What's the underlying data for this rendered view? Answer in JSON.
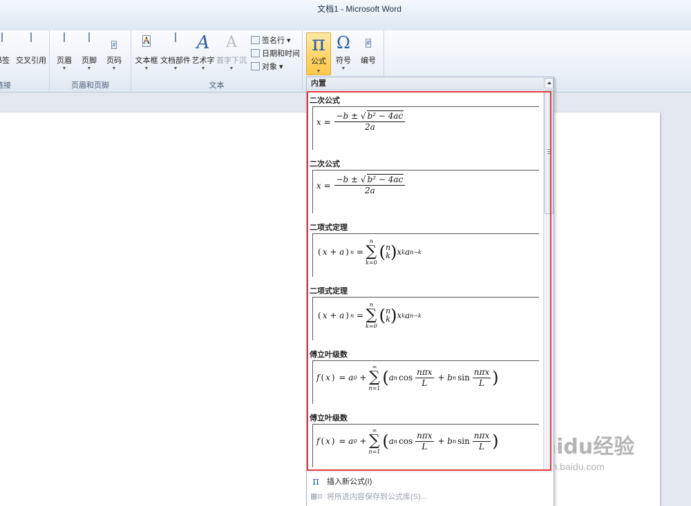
{
  "window": {
    "title": "文档1 - Microsoft Word"
  },
  "ribbon": {
    "groups": [
      {
        "label": "链接",
        "buttons": [
          {
            "label": "书签"
          },
          {
            "label": "交叉引用"
          }
        ]
      },
      {
        "label": "页眉和页脚",
        "buttons": [
          {
            "label": "页眉"
          },
          {
            "label": "页脚"
          },
          {
            "label": "页码"
          }
        ]
      },
      {
        "label": "文本",
        "buttons": [
          {
            "label": "文本框"
          },
          {
            "label": "文档部件"
          },
          {
            "label": "艺术字"
          },
          {
            "label": "首字下沉"
          }
        ],
        "small_buttons": [
          {
            "label": "签名行 ▾"
          },
          {
            "label": "日期和时间"
          },
          {
            "label": "对象 ▾"
          }
        ]
      },
      {
        "label": "",
        "buttons": [
          {
            "label": "公式",
            "glyph": "π"
          },
          {
            "label": "符号",
            "glyph": "Ω"
          },
          {
            "label": "编号",
            "glyph": "#"
          }
        ]
      }
    ]
  },
  "gallery": {
    "header": "内置",
    "items": [
      {
        "title": "二次公式"
      },
      {
        "title": "二次公式"
      },
      {
        "title": "二项式定理"
      },
      {
        "title": "二项式定理"
      },
      {
        "title": "傅立叶级数"
      },
      {
        "title": "傅立叶级数"
      }
    ],
    "menu": [
      {
        "label": "插入新公式(I)",
        "icon": "pi-icon",
        "enabled": true
      },
      {
        "label": "将所选内容保存到公式库(S)...",
        "icon": "save-to-gallery-icon",
        "enabled": false
      }
    ]
  },
  "watermark": {
    "line1": "Baidu经验",
    "line2": "jingyan.baidu.com"
  },
  "colors": {
    "highlight_frame": "#e53838",
    "equation_button": "#ffd66b"
  }
}
